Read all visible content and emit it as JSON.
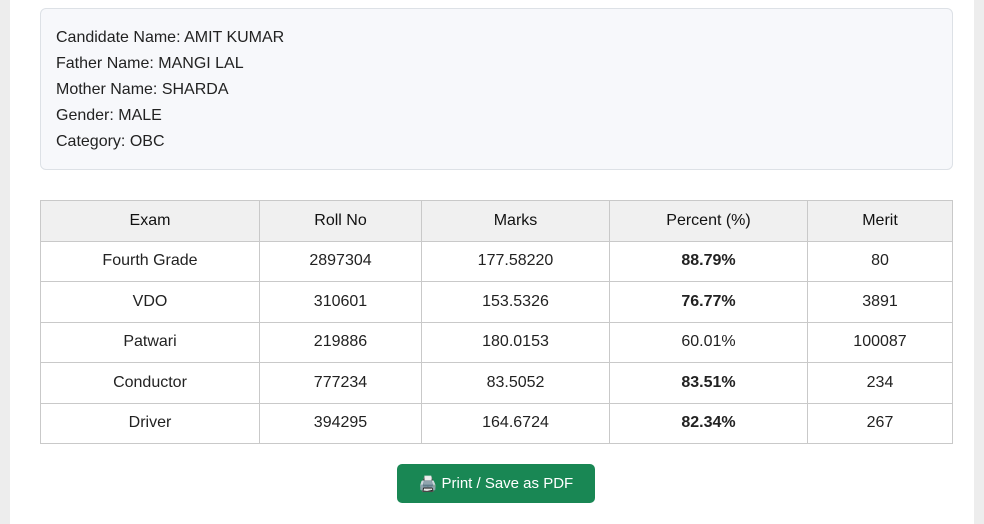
{
  "candidate": {
    "name_label": "Candidate Name:",
    "name_value": "AMIT KUMAR",
    "father_label": "Father Name:",
    "father_value": "MANGI LAL",
    "mother_label": "Mother Name:",
    "mother_value": "SHARDA",
    "gender_label": "Gender:",
    "gender_value": "MALE",
    "category_label": "Category:",
    "category_value": "OBC"
  },
  "table": {
    "headers": [
      "Exam",
      "Roll No",
      "Marks",
      "Percent (%)",
      "Merit"
    ],
    "rows": [
      {
        "exam": "Fourth Grade",
        "roll": "2897304",
        "marks": "177.58220",
        "percent": "88.79%",
        "merit": "80",
        "highlight": true
      },
      {
        "exam": "VDO",
        "roll": "310601",
        "marks": "153.5326",
        "percent": "76.77%",
        "merit": "3891",
        "highlight": true
      },
      {
        "exam": "Patwari",
        "roll": "219886",
        "marks": "180.0153",
        "percent": "60.01%",
        "merit": "100087",
        "highlight": false
      },
      {
        "exam": "Conductor",
        "roll": "777234",
        "marks": "83.5052",
        "percent": "83.51%",
        "merit": "234",
        "highlight": true
      },
      {
        "exam": "Driver",
        "roll": "394295",
        "marks": "164.6724",
        "percent": "82.34%",
        "merit": "267",
        "highlight": true
      }
    ]
  },
  "actions": {
    "print_icon": "printer-icon",
    "print_label": "Print / Save as PDF"
  },
  "colors": {
    "accent_green": "#198754",
    "percent_green": "#1e7e47"
  }
}
